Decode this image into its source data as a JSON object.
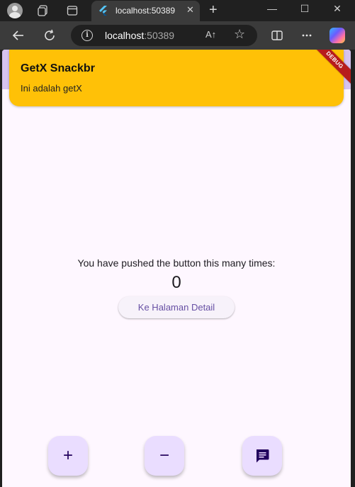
{
  "browser": {
    "tab_title": "localhost:50389",
    "tab_close": "✕",
    "new_tab": "+",
    "url_host": "localhost",
    "url_port": ":50389",
    "url_read_aloud": "A↑",
    "minimize": "—",
    "maximize": "☐",
    "close": "✕"
  },
  "snackbar": {
    "title": "GetX Snackbr",
    "message": "Ini adalah getX"
  },
  "debug_banner": "DEBUG",
  "body": {
    "counter_label": "You have pushed the button this many times:",
    "counter_value": "0",
    "detail_button": "Ke Halaman Detail"
  },
  "fabs": {
    "increment": "+",
    "decrement": "−"
  },
  "colors": {
    "snackbar": "#ffc107",
    "fab": "#eaddff",
    "background": "#fef7ff",
    "primary": "#6750a4"
  }
}
